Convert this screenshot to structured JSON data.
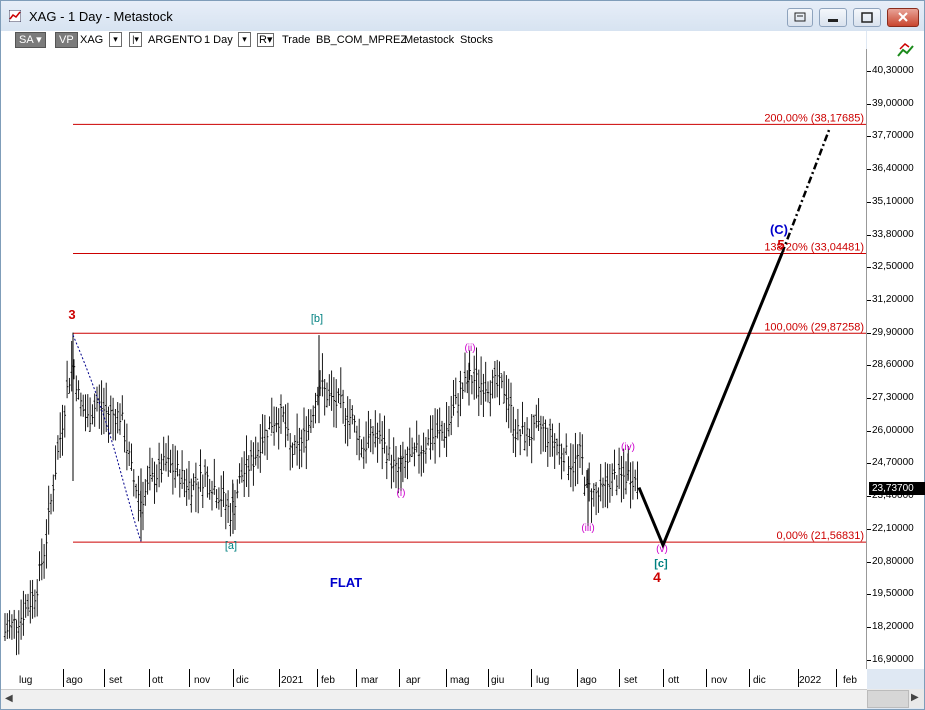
{
  "window": {
    "title": "XAG - 1 Day - Metastock"
  },
  "toolbar": {
    "sa": "SA",
    "vp": "VP",
    "symbol": "XAG",
    "instrument": "ARGENTO",
    "period": "1 Day",
    "r": "R",
    "trade": "Trade",
    "source": "BB_COM_MPREZ",
    "metastock": "Metastock",
    "stocks": "Stocks"
  },
  "right_axis": {
    "ticks": [
      "40,30000",
      "39,00000",
      "37,70000",
      "36,40000",
      "35,10000",
      "33,80000",
      "32,50000",
      "31,20000",
      "29,90000",
      "28,60000",
      "27,30000",
      "26,00000",
      "24,70000",
      "23,40000",
      "22,10000",
      "20,80000",
      "19,50000",
      "18,20000",
      "16,90000"
    ],
    "last_price": "23,73700"
  },
  "x_axis": {
    "labels": [
      "lug",
      "ago",
      "set",
      "ott",
      "nov",
      "dic",
      "2021",
      "feb",
      "mar",
      "apr",
      "mag",
      "giu",
      "lug",
      "ago",
      "set",
      "ott",
      "nov",
      "dic",
      "2022",
      "feb"
    ]
  },
  "chart_data": {
    "type": "bar",
    "title": "XAG - 1 Day - Metastock",
    "instrument": "ARGENTO",
    "ylim": [
      16.4,
      41.0
    ],
    "fib_levels": [
      {
        "label": "200,00% (38,17685)",
        "value": 38.17685,
        "color": "#cc0000"
      },
      {
        "label": "138,20% (33,04481)",
        "value": 33.04481,
        "color": "#cc0000"
      },
      {
        "label": "100,00% (29,87258)",
        "value": 29.87258,
        "color": "#cc0000"
      },
      {
        "label": "0,00% (21,56831)",
        "value": 21.56831,
        "color": "#cc0000"
      }
    ],
    "wave_labels": [
      {
        "text": "3",
        "color": "#cc0000"
      },
      {
        "text": "[b]",
        "color": "#008080"
      },
      {
        "text": "[a]",
        "color": "#008080"
      },
      {
        "text": "(ii)",
        "color": "#cc00cc"
      },
      {
        "text": "(i)",
        "color": "#cc00cc"
      },
      {
        "text": "(iii)",
        "color": "#cc00cc"
      },
      {
        "text": "(iv)",
        "color": "#cc00cc"
      },
      {
        "text": "(v)",
        "color": "#cc00cc"
      },
      {
        "text": "[c]",
        "color": "#008080"
      },
      {
        "text": "4",
        "color": "#cc0000"
      },
      {
        "text": "(C)",
        "color": "#0000cc"
      },
      {
        "text": "5",
        "color": "#cc0000"
      },
      {
        "text": "FLAT",
        "color": "#0000cc"
      }
    ],
    "last_price": 23.737
  }
}
